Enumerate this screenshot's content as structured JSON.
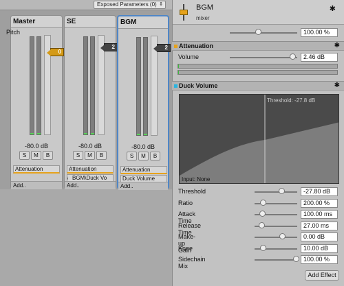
{
  "mixer": {
    "exposed_label": "Exposed Parameters (0)",
    "exposed_chevron": "⇕",
    "strips": [
      {
        "name": "Master",
        "fader_value": "0",
        "db": "-80.0 dB",
        "s": "S",
        "m": "M",
        "b": "B",
        "effects": [
          "Attenuation"
        ],
        "add": "Add.."
      },
      {
        "name": "SE",
        "fader_value": "2",
        "db": "-80.0 dB",
        "s": "S",
        "m": "M",
        "b": "B",
        "effects": [
          "Attenuation",
          "BGM\\Duck Vo"
        ],
        "send_prefix": "s",
        "add": "Add.."
      },
      {
        "name": "BGM",
        "fader_value": "2",
        "db": "-80.0 dB",
        "s": "S",
        "m": "M",
        "b": "B",
        "effects": [
          "Attenuation",
          "Duck Volume"
        ],
        "add": "Add.."
      }
    ]
  },
  "inspector": {
    "title": "BGM",
    "subtitle": "mixer",
    "pitch": {
      "label": "Pitch",
      "value": "100.00 %",
      "level": 0.42
    },
    "attenuation": {
      "title": "Attenuation",
      "volume_label": "Volume",
      "volume_value": "2.46 dB",
      "level": 0.93
    },
    "duck": {
      "title": "Duck Volume",
      "threshold_text": "Threshold: -27.8 dB",
      "input_text": "Input: None",
      "params": [
        {
          "label": "Threshold",
          "value": "-27.80 dB",
          "level": 0.64
        },
        {
          "label": "Ratio",
          "value": "200.00 %",
          "level": 0.2
        },
        {
          "label": "Attack Time",
          "value": "100.00 ms",
          "level": 0.18
        },
        {
          "label": "Release Time",
          "value": "27.00 ms",
          "level": 0.17
        },
        {
          "label": "Make-up Gain",
          "value": "0.00 dB",
          "level": 0.65
        },
        {
          "label": "Knee",
          "value": "10.00 dB",
          "level": 0.2
        },
        {
          "label": "Sidechain Mix",
          "value": "100.00 %",
          "level": 0.98
        }
      ]
    },
    "add_effect": "Add Effect",
    "gear": "✱",
    "colors": {
      "attenuation": "#e6a21b",
      "duck": "#2ab5e0",
      "selected": "#4f86c6"
    }
  }
}
